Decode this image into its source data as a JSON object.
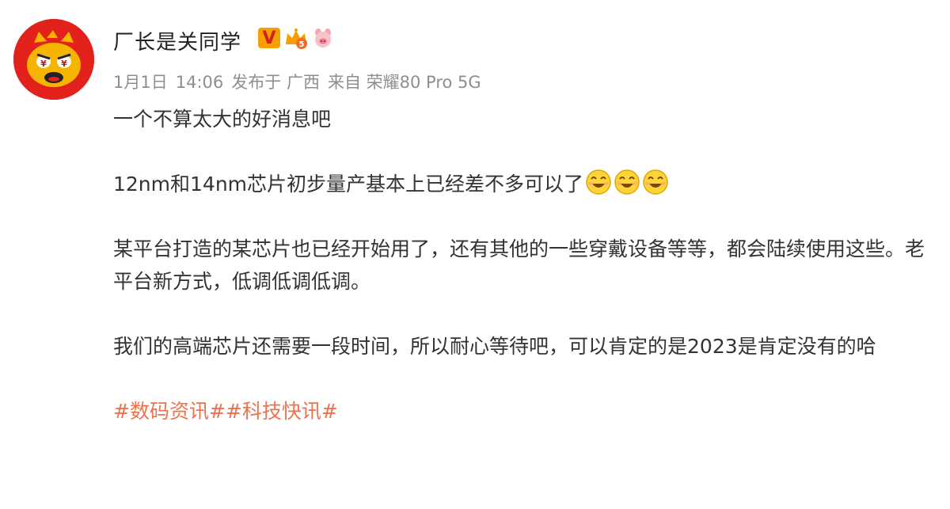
{
  "user": {
    "name": "厂长是关同学",
    "verified_badge": "V",
    "vip_level": "5"
  },
  "meta": {
    "date": "1月1日",
    "time": "14:06",
    "published_in": "发布于 广西",
    "source": "来自 荣耀80 Pro 5G"
  },
  "post": {
    "line1": "一个不算太大的好消息吧",
    "line2": "12nm和14nm芯片初步量产基本上已经差不多可以了",
    "emoji_count": 3,
    "para3": "某平台打造的某芯片也已经开始用了，还有其他的一些穿戴设备等等，都会陆续使用这些。老平台新方式，低调低调低调。",
    "para4": "我们的高端芯片还需要一段时间，所以耐心等待吧，可以肯定的是2023是肯定没有的哈",
    "hashtags": [
      "#数码资讯#",
      "#科技快讯#"
    ]
  },
  "colors": {
    "avatar_bg": "#e2211c",
    "hashtag": "#eb7350",
    "meta_text": "#8e8e8e",
    "vip_gold": "#f5a000"
  }
}
